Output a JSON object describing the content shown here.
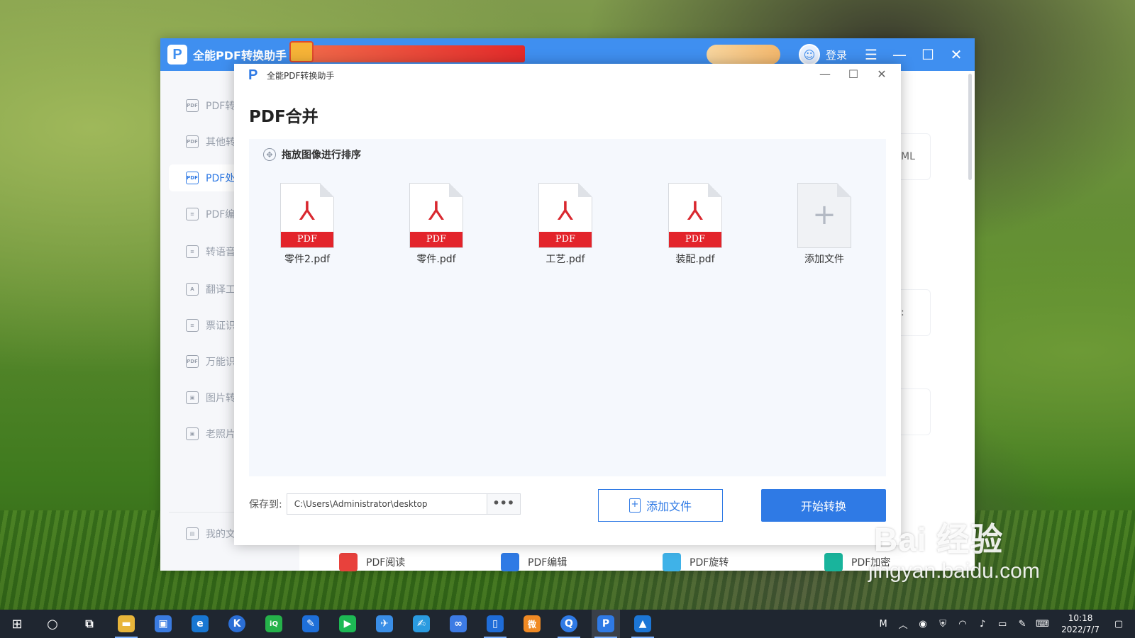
{
  "app": {
    "title": "全能PDF转换助手",
    "login_label": "登录"
  },
  "sidebar": {
    "items": [
      {
        "label": "PDF转",
        "icon": "pdf-icon"
      },
      {
        "label": "其他转",
        "icon": "pdf-icon"
      },
      {
        "label": "PDF处",
        "icon": "pdf-process-icon"
      },
      {
        "label": "PDF编",
        "icon": "pdf-edit-icon"
      },
      {
        "label": "转语音",
        "icon": "voice-doc-icon"
      },
      {
        "label": "翻译工",
        "icon": "translate-icon"
      },
      {
        "label": "票证识",
        "icon": "ticket-icon"
      },
      {
        "label": "万能识",
        "icon": "pdf-icon"
      },
      {
        "label": "图片转",
        "icon": "image-icon"
      },
      {
        "label": "老照片",
        "icon": "photo-icon"
      }
    ],
    "my_files": "我的文件"
  },
  "main_peek": {
    "row1_text": "ML",
    "row2_text": ":"
  },
  "bottom_tools": [
    {
      "label": "PDF阅读",
      "color": "#e8413c"
    },
    {
      "label": "PDF编辑",
      "color": "#2f7ae5"
    },
    {
      "label": "PDF旋转",
      "color": "#3fb2e8"
    },
    {
      "label": "PDF加密",
      "color": "#19b49c"
    }
  ],
  "dialog": {
    "title": "全能PDF转换助手",
    "heading": "PDF合并",
    "sort_hint": "拖放图像进行排序",
    "files": [
      {
        "name": "零件2.pdf",
        "badge": "PDF"
      },
      {
        "name": "零件.pdf",
        "badge": "PDF"
      },
      {
        "name": "工艺.pdf",
        "badge": "PDF"
      },
      {
        "name": "装配.pdf",
        "badge": "PDF"
      }
    ],
    "add_tile_label": "添加文件",
    "save_label": "保存到:",
    "save_path": "C:\\Users\\Administrator\\desktop",
    "dots": "•••",
    "add_file_button": "添加文件",
    "start_button": "开始转换"
  },
  "watermark": {
    "logo": "Bai 经验",
    "url": "jingyan.baidu.com"
  },
  "taskbar": {
    "apps": [
      {
        "name": "search-icon",
        "color": "#1f2630",
        "glyph": "○"
      },
      {
        "name": "task-view-icon",
        "color": "#1f2630",
        "glyph": "⧉"
      },
      {
        "name": "file-explorer-icon",
        "color": "#e8b53a",
        "glyph": "▬"
      },
      {
        "name": "store-icon",
        "color": "#3a7be0",
        "glyph": "▣"
      },
      {
        "name": "edge-icon",
        "color": "#1877d2",
        "glyph": "e"
      },
      {
        "name": "k-app-icon",
        "color": "#2b6fd6",
        "glyph": "K"
      },
      {
        "name": "iqiyi-icon",
        "color": "#25b24a",
        "glyph": "iQ"
      },
      {
        "name": "pen-app-icon",
        "color": "#1e6fd9",
        "glyph": "✎"
      },
      {
        "name": "media-player-icon",
        "color": "#1db954",
        "glyph": "▶"
      },
      {
        "name": "feishu-icon",
        "color": "#3a8ee6",
        "glyph": "✈"
      },
      {
        "name": "sign-app-icon",
        "color": "#2a9be0",
        "glyph": "✍"
      },
      {
        "name": "link-app-icon",
        "color": "#3d7be4",
        "glyph": "∞"
      },
      {
        "name": "phone-app-icon",
        "color": "#1f6dd8",
        "glyph": "▯"
      },
      {
        "name": "weibo-icon",
        "color": "#f08a24",
        "glyph": "微"
      },
      {
        "name": "browser-q-icon",
        "color": "#2f7ae5",
        "glyph": "Q"
      },
      {
        "name": "pdf-assistant-icon",
        "color": "#2f7ae5",
        "glyph": "P"
      },
      {
        "name": "photos-icon",
        "color": "#1c76d6",
        "glyph": "▲"
      }
    ],
    "tray_m": "M",
    "time": "10:18",
    "date": "2022/7/7"
  }
}
